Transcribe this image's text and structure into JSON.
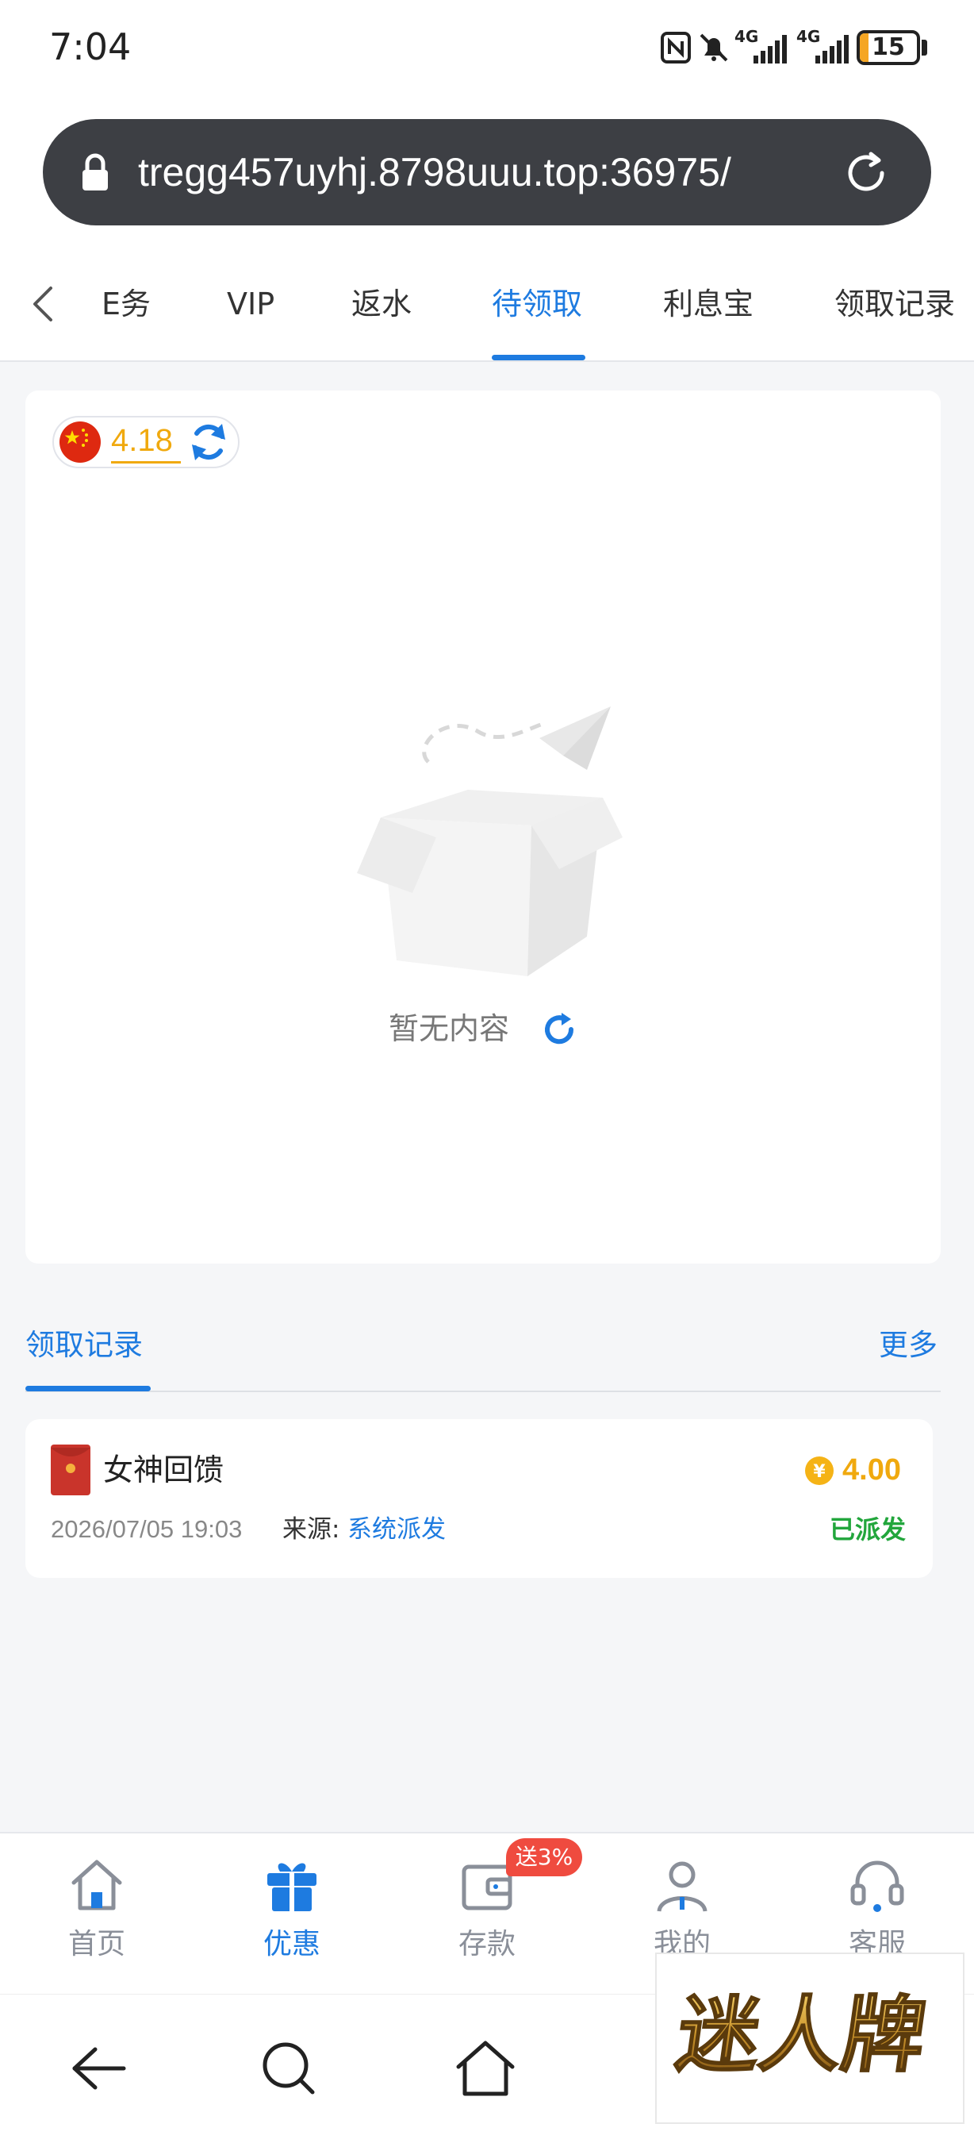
{
  "status_bar": {
    "time": "7:04",
    "network_1": "4G",
    "network_2": "4G",
    "battery_level": 15,
    "battery_text": "15",
    "icons": [
      "nfc-icon",
      "bell-muted-icon",
      "signal-icon",
      "signal-icon",
      "battery-icon"
    ]
  },
  "browser": {
    "url": "tregg457uyhj.8798uuu.top:36975/",
    "icons": [
      "lock-icon",
      "reload-icon"
    ]
  },
  "tabs": {
    "items": [
      {
        "label": "任务"
      },
      {
        "label": "VIP"
      },
      {
        "label": "返水"
      },
      {
        "label": "待领取",
        "active": true
      },
      {
        "label": "利息宝"
      },
      {
        "label": "领取记录"
      }
    ],
    "visible_first": "E务"
  },
  "balance": {
    "value": "4.18"
  },
  "empty_state": {
    "text": "暂无内容"
  },
  "records": {
    "title": "领取记录",
    "more": "更多",
    "items": [
      {
        "name": "女神回馈",
        "amount": "4.00",
        "date": "2026/07/05 19:03",
        "source_label": "来源:",
        "source": "系统派发",
        "status": "已派发"
      }
    ]
  },
  "bottom_nav": {
    "items": [
      {
        "label": "首页",
        "icon": "home-icon"
      },
      {
        "label": "优惠",
        "icon": "gift-icon",
        "active": true
      },
      {
        "label": "存款",
        "icon": "wallet-icon"
      },
      {
        "label": "我的",
        "icon": "user-icon"
      },
      {
        "label": "客服",
        "icon": "headset-icon"
      }
    ],
    "deposit_badge": "送3%"
  },
  "system_nav": {
    "icons": [
      "back-icon",
      "search-icon",
      "home-icon"
    ]
  },
  "watermark": {
    "text": "迷人牌"
  },
  "colors": {
    "accent": "#1e7be0",
    "gold": "#f0a90e",
    "success": "#22a63c",
    "badge": "#ef4b3f"
  }
}
